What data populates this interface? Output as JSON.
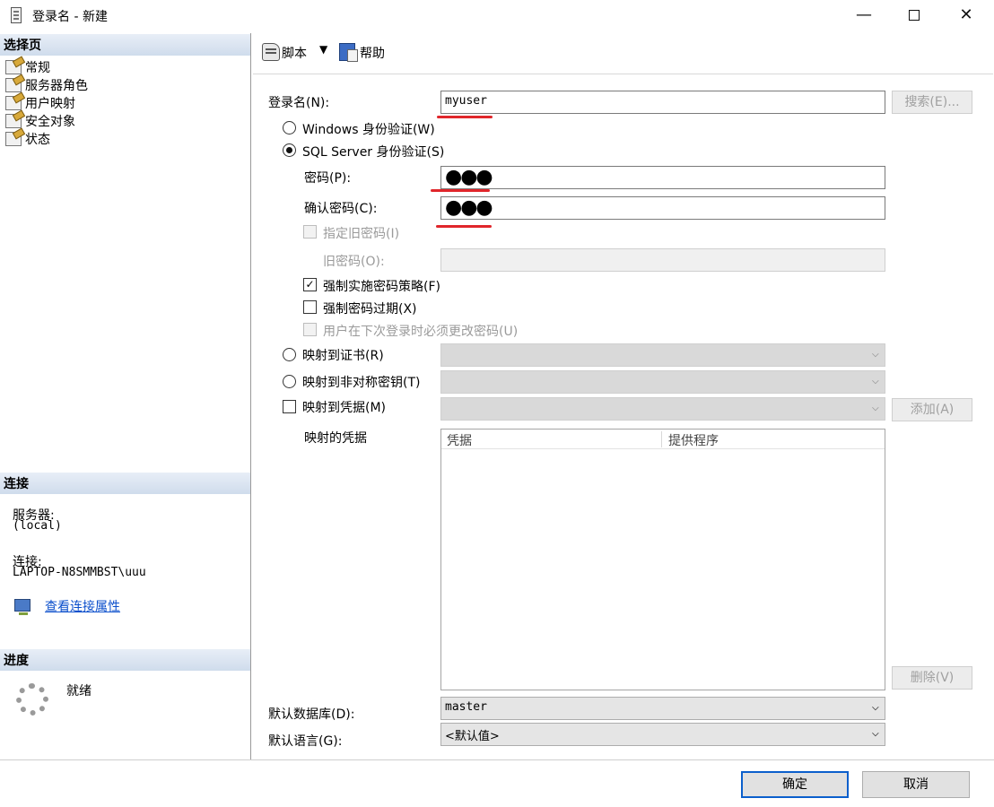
{
  "window": {
    "title": "登录名 - 新建",
    "minimize_glyph": "—",
    "close_glyph": "✕"
  },
  "left": {
    "select_page_header": "选择页",
    "pages": [
      {
        "label": "常规",
        "icon": "page-icon"
      },
      {
        "label": "服务器角色",
        "icon": "page-icon"
      },
      {
        "label": "用户映射",
        "icon": "page-icon"
      },
      {
        "label": "安全对象",
        "icon": "page-icon"
      },
      {
        "label": "状态",
        "icon": "page-icon"
      }
    ],
    "connection_header": "连接",
    "server_label": "服务器:",
    "server_value": "(local)",
    "connection_label": "连接:",
    "connection_value": "LAPTOP-N8SMMBST\\uuu",
    "conn_props_link": "查看连接属性",
    "progress_header": "进度",
    "progress_status": "就绪"
  },
  "toolbar": {
    "script_label": "脚本",
    "script_dropdown": "▼",
    "help_label": "帮助"
  },
  "form": {
    "login_name_label": "登录名(N):",
    "login_name_value": "myuser",
    "search_button": "搜索(E)...",
    "windows_auth_label": "Windows 身份验证(W)",
    "sql_auth_label": "SQL Server 身份验证(S)",
    "password_label": "密码(P):",
    "password_value": "●●●",
    "confirm_label": "确认密码(C):",
    "confirm_value": "●●●",
    "specify_old_label": "指定旧密码(I)",
    "old_password_label": "旧密码(O):",
    "enforce_policy_label": "强制实施密码策略(F)",
    "enforce_policy_check": "✓",
    "enforce_expiration_label": "强制密码过期(X)",
    "must_change_label": "用户在下次登录时必须更改密码(U)",
    "map_cert_label": "映射到证书(R)",
    "map_asym_label": "映射到非对称密钥(T)",
    "map_cred_label": "映射到凭据(M)",
    "add_button": "添加(A)",
    "mapped_creds_label": "映射的凭据",
    "grid_columns": [
      "凭据",
      "提供程序"
    ],
    "remove_button": "删除(V)",
    "default_db_label": "默认数据库(D):",
    "default_db_value": "master",
    "default_lang_label": "默认语言(G):",
    "default_lang_value": "<默认值>",
    "combo_arrow": "⌵"
  },
  "footer": {
    "ok_button": "确定",
    "cancel_button": "取消"
  },
  "colors": {
    "annotation_red": "#e0262b",
    "link_blue": "#0b4fcc",
    "default_button_border": "#0b5fcc"
  }
}
